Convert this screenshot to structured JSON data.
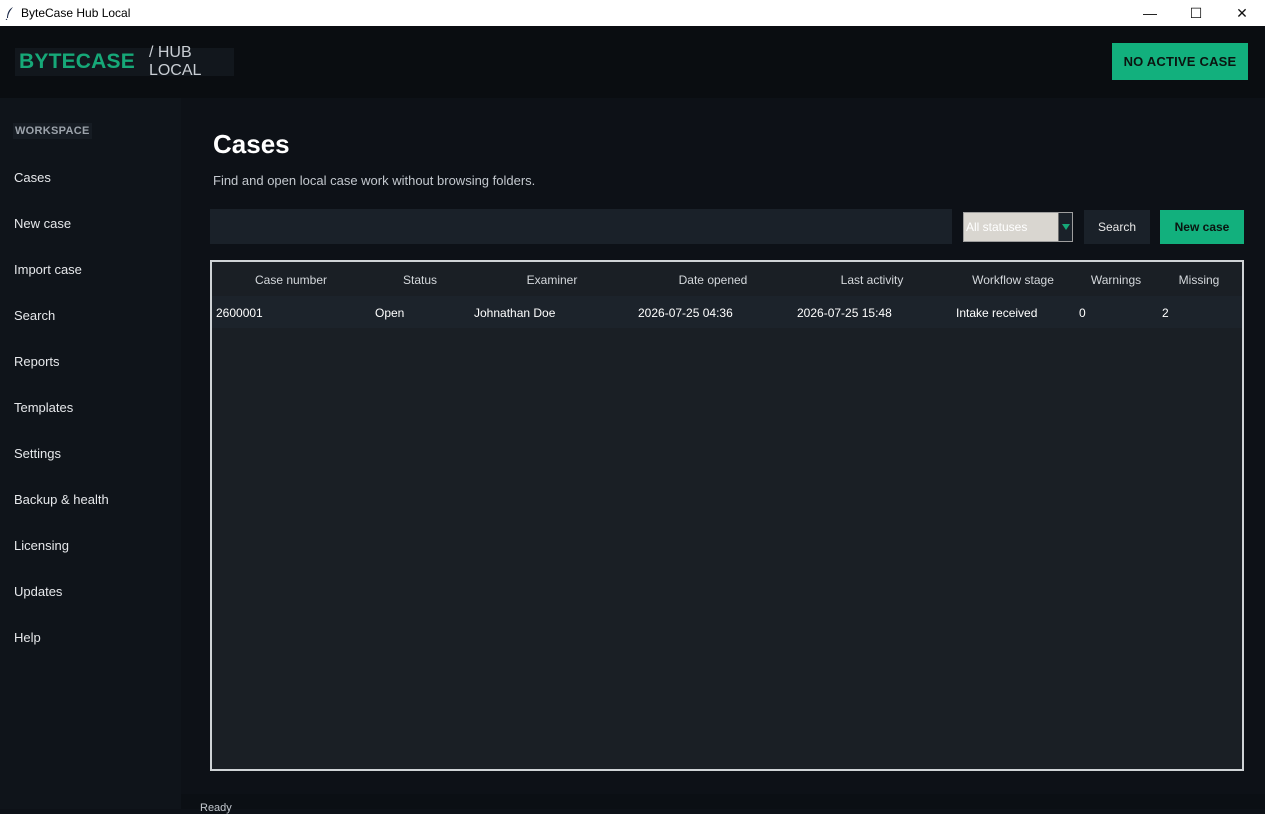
{
  "window": {
    "title": "ByteCase Hub Local",
    "controls": {
      "minimize": "—",
      "maximize": "☐",
      "close": "✕"
    }
  },
  "header": {
    "brand": "BYTECASE",
    "sub": "/ HUB LOCAL",
    "case_badge": "NO ACTIVE CASE"
  },
  "sidebar": {
    "section": "WORKSPACE",
    "items": [
      {
        "label": "Cases"
      },
      {
        "label": "New case"
      },
      {
        "label": "Import case"
      },
      {
        "label": "Search"
      },
      {
        "label": "Reports"
      },
      {
        "label": "Templates"
      },
      {
        "label": "Settings"
      },
      {
        "label": "Backup & health"
      },
      {
        "label": "Licensing"
      },
      {
        "label": "Updates"
      },
      {
        "label": "Help"
      }
    ]
  },
  "main": {
    "title": "Cases",
    "subtitle": "Find and open local case work without browsing folders.",
    "search_value": "",
    "status_filter": "All statuses",
    "search_button": "Search",
    "new_case_button": "New case",
    "table": {
      "columns": [
        "Case number",
        "Status",
        "Examiner",
        "Date opened",
        "Last activity",
        "Workflow stage",
        "Warnings",
        "Missing"
      ],
      "rows": [
        [
          "2600001",
          "Open",
          "Johnathan Doe",
          "2026-07-25 04:36",
          "2026-07-25 15:48",
          "Intake received",
          "0",
          "2"
        ]
      ]
    }
  },
  "statusbar": {
    "text": "Ready"
  },
  "colors": {
    "accent": "#12b07d",
    "brand": "#16a878",
    "background": "#0d1117",
    "panel": "#1a1f25"
  }
}
